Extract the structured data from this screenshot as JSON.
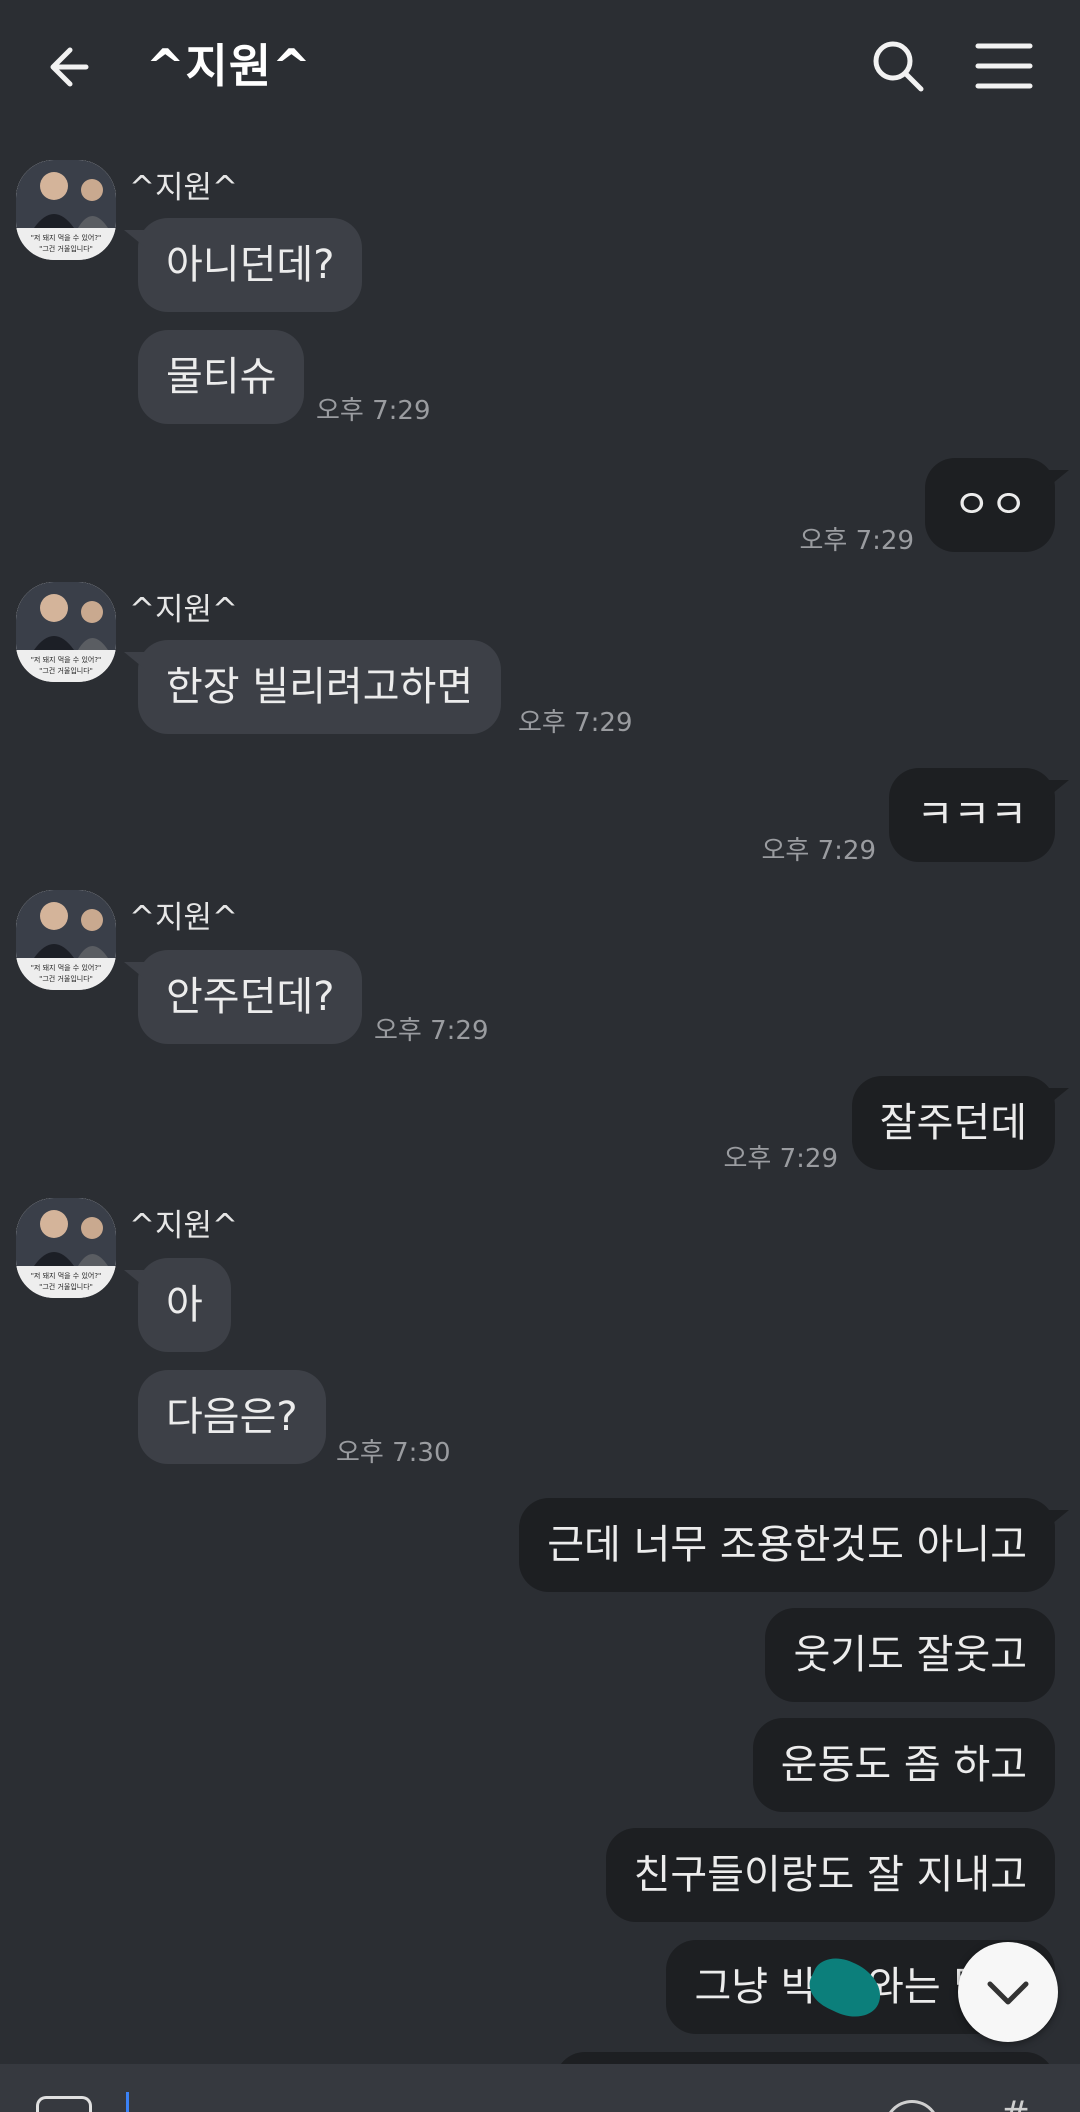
{
  "header": {
    "title": "^지원^",
    "back_icon": "arrow-left-icon",
    "search_icon": "search-icon",
    "menu_icon": "hamburger-menu-icon"
  },
  "chat": {
    "sender_name": "^지원^",
    "avatar_caption_line1": "\"저 돼지 먹을 수 있어?\"",
    "avatar_caption_line2": "\"그건 거울입니다\"",
    "messages": [
      {
        "dir": "in",
        "text": "아니던데?"
      },
      {
        "dir": "in",
        "text": "물티슈",
        "time": "오후 7:29"
      },
      {
        "dir": "out",
        "text": "ㅇㅇ",
        "time": "오후 7:29"
      },
      {
        "dir": "in",
        "text": "한장 빌리려고하면",
        "time": "오후 7:29"
      },
      {
        "dir": "out",
        "text": "ㅋㅋㅋ",
        "time": "오후 7:29"
      },
      {
        "dir": "in",
        "text": "안주던데?",
        "time": "오후 7:29"
      },
      {
        "dir": "out",
        "text": "잘주던데",
        "time": "오후 7:29"
      },
      {
        "dir": "in",
        "text": "아"
      },
      {
        "dir": "in",
        "text": "다음은?",
        "time": "오후 7:30"
      },
      {
        "dir": "out",
        "text": "근데 너무 조용한것도 아니고"
      },
      {
        "dir": "out",
        "text": "웃기도 잘웃고"
      },
      {
        "dir": "out",
        "text": "운동도 좀 하고"
      },
      {
        "dir": "out",
        "text": "친구들이랑도 잘 지내고"
      },
      {
        "dir": "out",
        "text": "그냥 박준 와는 탈기"
      }
    ]
  },
  "colors": {
    "background": "#2b2e33",
    "incoming_bubble": "#3d4047",
    "outgoing_bubble": "#1d1f22",
    "timestamp": "#9a9ca0",
    "scribble": "#0c7f7b"
  },
  "controls": {
    "scroll_down_icon": "chevron-down-icon",
    "attach_icon": "plus-icon",
    "emoji_icon": "emoji-icon",
    "hash_icon": "hash-icon",
    "hash_glyph": "#"
  }
}
